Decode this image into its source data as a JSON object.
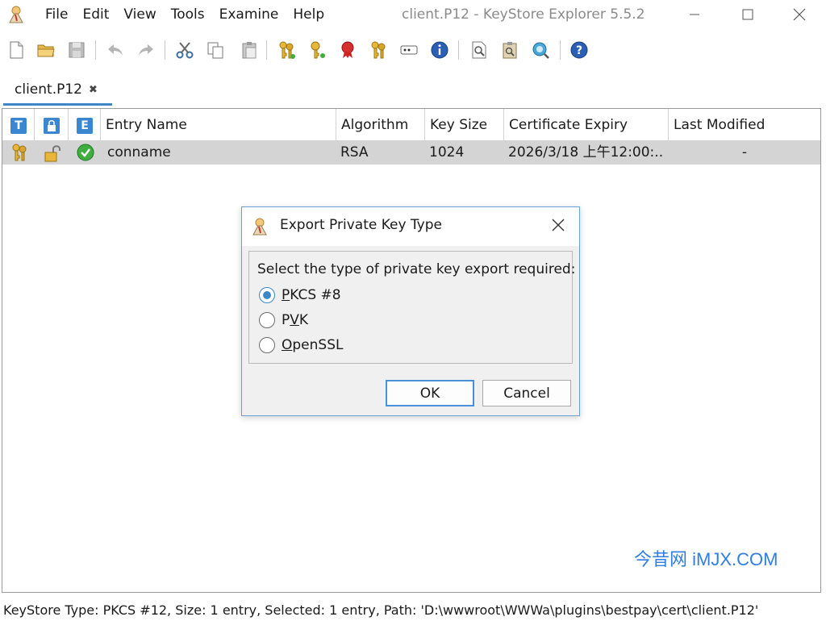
{
  "menu": [
    "File",
    "Edit",
    "View",
    "Tools",
    "Examine",
    "Help"
  ],
  "window_title": "client.P12 - KeyStore Explorer 5.5.2",
  "tab": {
    "label": "client.P12"
  },
  "table": {
    "header_icons": [
      "T",
      "",
      "E"
    ],
    "columns": [
      "Entry Name",
      "Algorithm",
      "Key Size",
      "Certificate Expiry",
      "Last Modified"
    ],
    "rows": [
      {
        "entry_name": "conname",
        "algorithm": "RSA",
        "key_size": "1024",
        "expiry": "2026/3/18 上午12:00:...",
        "last_modified": "-"
      }
    ]
  },
  "dialog": {
    "title": "Export Private Key Type",
    "prompt": "Select the type of private key export required:",
    "options": [
      {
        "label": "PKCS #8",
        "mnemonic": "P",
        "checked": true
      },
      {
        "label": "PVK",
        "mnemonic": "V",
        "checked": false
      },
      {
        "label": "OpenSSL",
        "mnemonic": "O",
        "checked": false
      }
    ],
    "ok_label": "OK",
    "cancel_label": "Cancel"
  },
  "watermark": "今昔网 iMJX.COM",
  "status": "KeyStore Type: PKCS #12, Size: 1 entry, Selected: 1 entry, Path: 'D:\\wwwroot\\WWWa\\plugins\\bestpay\\cert\\client.P12'",
  "colors": {
    "accent": "#3d87c6",
    "selected_row": "#d4d4d4",
    "watermark": "#2f7ee0"
  }
}
